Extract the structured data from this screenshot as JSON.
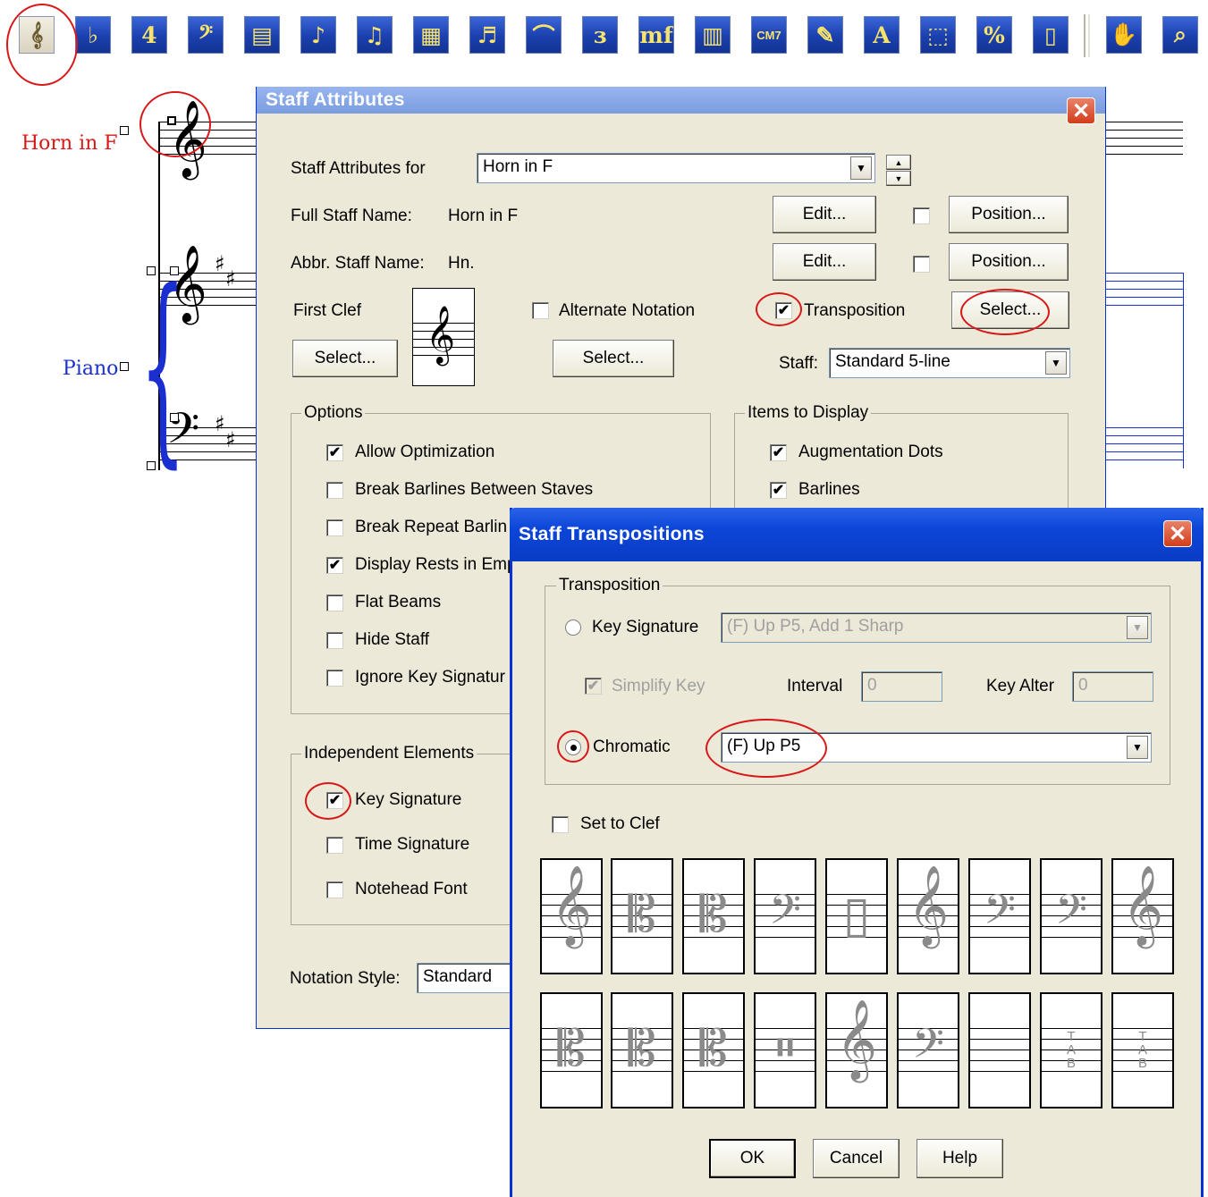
{
  "toolbar": {
    "buttons": [
      {
        "name": "staff-tool",
        "glyph": "𝄞"
      },
      {
        "name": "key-signature-tool",
        "glyph": "♭"
      },
      {
        "name": "time-signature-tool",
        "glyph": "4"
      },
      {
        "name": "clef-tool",
        "glyph": "𝄢"
      },
      {
        "name": "measure-tool",
        "glyph": "▤"
      },
      {
        "name": "simple-entry-tool",
        "glyph": "♪"
      },
      {
        "name": "speedy-entry-tool",
        "glyph": "♫"
      },
      {
        "name": "hyperscribe-tool",
        "glyph": "▦"
      },
      {
        "name": "tuplet-tool",
        "glyph": "♬"
      },
      {
        "name": "smart-shape-tool",
        "glyph": "⌒"
      },
      {
        "name": "articulation-tool",
        "glyph": "ɜ"
      },
      {
        "name": "expression-tool",
        "glyph": "mf"
      },
      {
        "name": "repeat-tool",
        "glyph": "▥"
      },
      {
        "name": "chord-tool",
        "glyph": "CM7"
      },
      {
        "name": "lyrics-tool",
        "glyph": "✎"
      },
      {
        "name": "text-tool",
        "glyph": "A"
      },
      {
        "name": "selection-tool",
        "glyph": "⬚"
      },
      {
        "name": "resize-tool",
        "glyph": "%"
      },
      {
        "name": "page-layout-tool",
        "glyph": "▯"
      },
      {
        "name": "hand-grabber-tool",
        "glyph": "✋"
      },
      {
        "name": "zoom-tool",
        "glyph": "⌕"
      }
    ]
  },
  "score": {
    "horn_label": "Horn in F",
    "piano_label": "Piano",
    "colors": {
      "horn": "#d81818",
      "piano": "#1b2fd0"
    }
  },
  "staff_attributes": {
    "title": "Staff Attributes",
    "for_label": "Staff Attributes for",
    "for_value": "Horn in F",
    "full_name_label": "Full Staff Name:",
    "full_name_value": "Horn in F",
    "abbr_name_label": "Abbr. Staff Name:",
    "abbr_name_value": "Hn.",
    "edit_label": "Edit...",
    "position_label": "Position...",
    "first_clef_label": "First Clef",
    "select_label": "Select...",
    "alternate_notation_label": "Alternate Notation",
    "transposition_label": "Transposition",
    "staff_label": "Staff:",
    "staff_value": "Standard 5-line",
    "options_label": "Options",
    "options": [
      {
        "label": "Allow Optimization",
        "checked": true
      },
      {
        "label": "Break Barlines Between Staves",
        "checked": false
      },
      {
        "label": "Break Repeat Barlin",
        "checked": false
      },
      {
        "label": "Display Rests in Emp",
        "checked": true
      },
      {
        "label": "Flat Beams",
        "checked": false
      },
      {
        "label": "Hide Staff",
        "checked": false
      },
      {
        "label": "Ignore Key Signatur",
        "checked": false
      }
    ],
    "items_to_display_label": "Items to Display",
    "items_to_display": [
      {
        "label": "Augmentation Dots",
        "checked": true
      },
      {
        "label": "Barlines",
        "checked": true
      }
    ],
    "independent_label": "Independent Elements",
    "independent": [
      {
        "label": "Key Signature",
        "checked": true
      },
      {
        "label": "Time Signature",
        "checked": false
      },
      {
        "label": "Notehead Font",
        "checked": false
      }
    ],
    "notation_style_label": "Notation Style:",
    "notation_style_value": "Standard"
  },
  "staff_transpositions": {
    "title": "Staff Transpositions",
    "transposition_group": "Transposition",
    "key_signature_label": "Key Signature",
    "key_signature_value": "(F) Up P5, Add 1 Sharp",
    "simplify_key_label": "Simplify Key",
    "interval_label": "Interval",
    "interval_value": "0",
    "key_alter_label": "Key Alter",
    "key_alter_value": "0",
    "chromatic_label": "Chromatic",
    "chromatic_value": "(F) Up P5",
    "set_to_clef_label": "Set to Clef",
    "ok_label": "OK",
    "cancel_label": "Cancel",
    "help_label": "Help",
    "clefs_row1": [
      {
        "glyph": "𝄞",
        "name": "treble"
      },
      {
        "glyph": "𝄡",
        "name": "alto"
      },
      {
        "glyph": "𝄡",
        "name": "tenor"
      },
      {
        "glyph": "𝄢",
        "name": "bass"
      },
      {
        "glyph": "▯",
        "name": "percussion"
      },
      {
        "glyph": "𝄞",
        "name": "treble-8vb"
      },
      {
        "glyph": "𝄢",
        "name": "bass-8vb"
      },
      {
        "glyph": "𝄢",
        "name": "baritone"
      },
      {
        "glyph": "𝄞",
        "name": "french-violin"
      }
    ],
    "clefs_row2": [
      {
        "glyph": "𝄡",
        "name": "soprano"
      },
      {
        "glyph": "𝄡",
        "name": "mezzo-soprano"
      },
      {
        "glyph": "𝄡",
        "name": "baritone-c"
      },
      {
        "glyph": "𝄥",
        "name": "percussion-2"
      },
      {
        "glyph": "𝄞",
        "name": "treble-8va"
      },
      {
        "glyph": "𝄢",
        "name": "bass-8va"
      },
      {
        "glyph": "",
        "name": "blank"
      },
      {
        "glyph": "TAB",
        "name": "tab"
      },
      {
        "glyph": "TAB",
        "name": "tab-small"
      }
    ]
  }
}
